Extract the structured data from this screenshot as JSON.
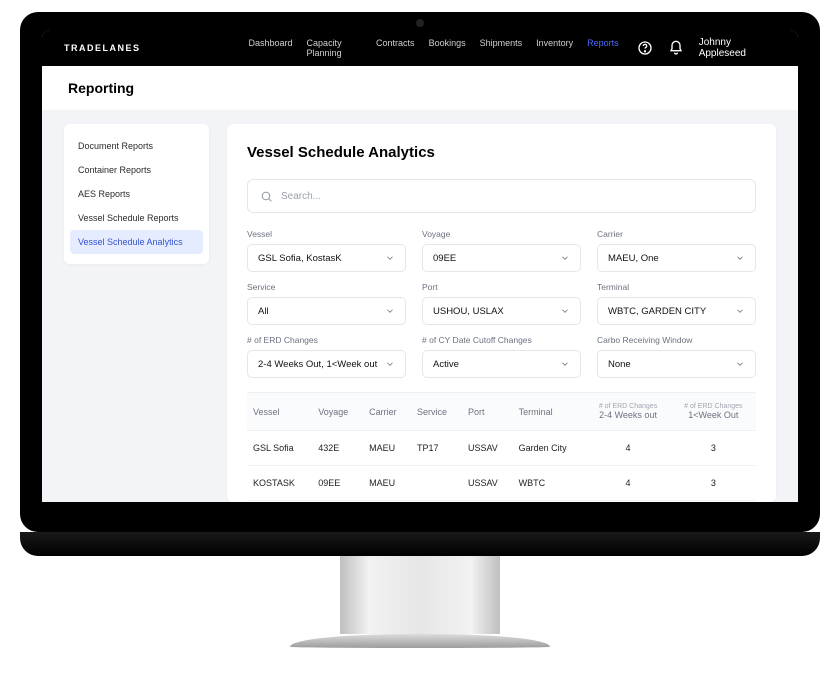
{
  "brand": "TRADELANES",
  "user": "Johnny Appleseed",
  "nav": {
    "items": [
      {
        "label": "Dashboard",
        "active": false
      },
      {
        "label": "Capacity Planning",
        "active": false
      },
      {
        "label": "Contracts",
        "active": false
      },
      {
        "label": "Bookings",
        "active": false
      },
      {
        "label": "Shipments",
        "active": false
      },
      {
        "label": "Inventory",
        "active": false
      },
      {
        "label": "Reports",
        "active": true
      }
    ]
  },
  "page_heading": "Reporting",
  "sidebar": {
    "items": [
      {
        "label": "Document Reports",
        "active": false
      },
      {
        "label": "Container Reports",
        "active": false
      },
      {
        "label": "AES Reports",
        "active": false
      },
      {
        "label": "Vessel Schedule Reports",
        "active": false
      },
      {
        "label": "Vessel Schedule Analytics",
        "active": true
      }
    ]
  },
  "panel": {
    "title": "Vessel Schedule Analytics",
    "search_placeholder": "Search..."
  },
  "filters": [
    {
      "label": "Vessel",
      "value": "GSL Sofia, KostasK"
    },
    {
      "label": "Voyage",
      "value": "09EE"
    },
    {
      "label": "Carrier",
      "value": "MAEU, One"
    },
    {
      "label": "Service",
      "value": "All"
    },
    {
      "label": "Port",
      "value": "USHOU, USLAX"
    },
    {
      "label": "Terminal",
      "value": "WBTC, GARDEN CITY"
    },
    {
      "label": "# of ERD Changes",
      "value": "2-4 Weeks Out, 1<Week out"
    },
    {
      "label": "# of CY Date Cutoff Changes",
      "value": "Active"
    },
    {
      "label": "Carbo Receiving Window",
      "value": "None"
    }
  ],
  "table": {
    "headers": {
      "vessel": "Vessel",
      "voyage": "Voyage",
      "carrier": "Carrier",
      "service": "Service",
      "port": "Port",
      "terminal": "Terminal",
      "erd_group_label": "# of ERD Changes",
      "erd_col_a": "2-4 Weeks out",
      "erd_col_b": "1<Week Out"
    },
    "rows": [
      {
        "vessel": "GSL Sofia",
        "voyage": "432E",
        "carrier": "MAEU",
        "service": "TP17",
        "port": "USSAV",
        "terminal": "Garden City",
        "erd_a": "4",
        "erd_b": "3"
      },
      {
        "vessel": "KOSTASK",
        "voyage": "09EE",
        "carrier": "MAEU",
        "service": "",
        "port": "USSAV",
        "terminal": "WBTC",
        "erd_a": "4",
        "erd_b": "3"
      }
    ]
  }
}
